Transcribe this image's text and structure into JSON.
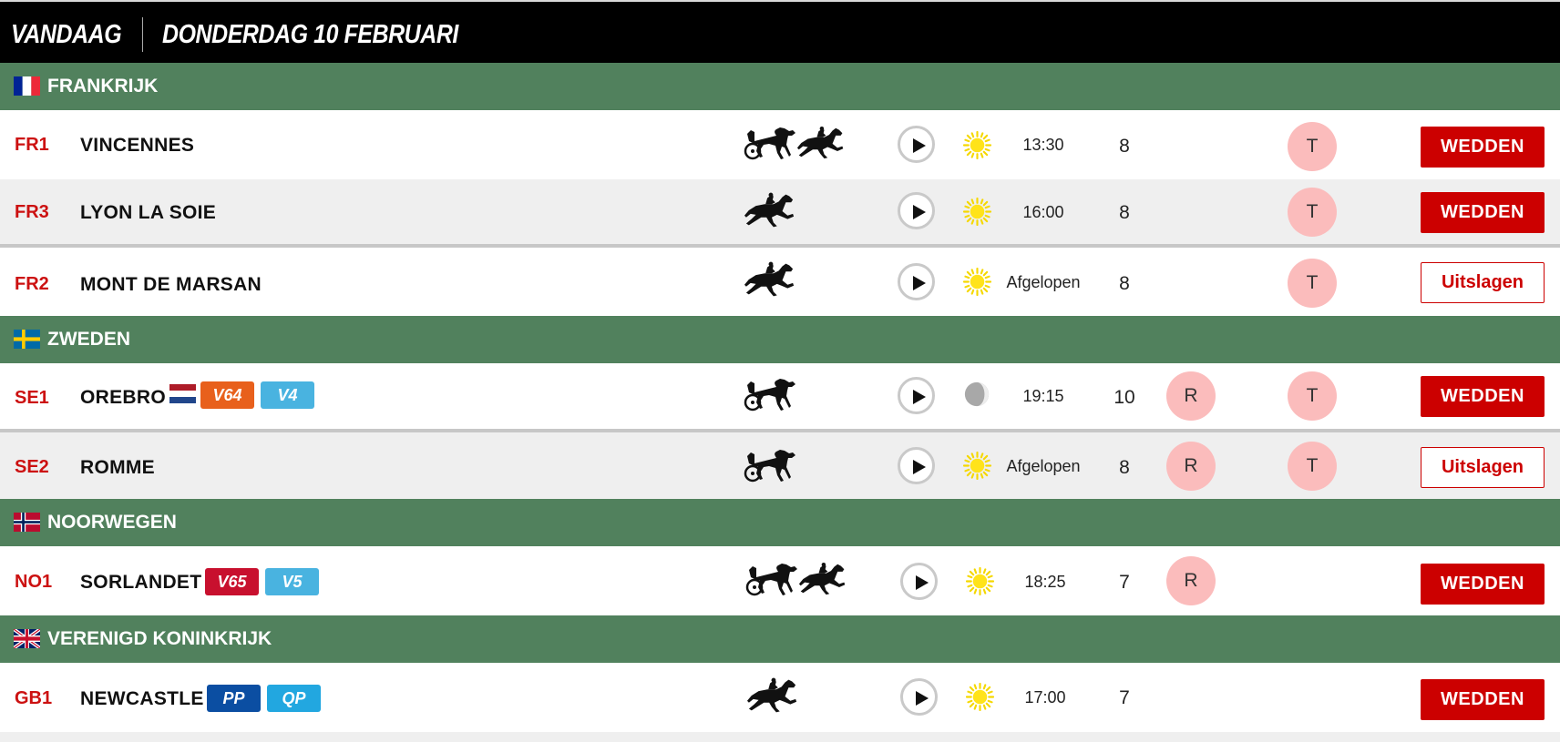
{
  "header": {
    "today_label": "VANDAAG",
    "date_label": "DONDERDAG 10 FEBRUARI"
  },
  "countries": [
    {
      "name": "FRANKRIJK",
      "flag": "france-flag-icon"
    },
    {
      "name": "ZWEDEN",
      "flag": "sweden-flag-icon"
    },
    {
      "name": "NOORWEGEN",
      "flag": "norway-flag-icon"
    },
    {
      "name": "VERENIGD KONINKRIJK",
      "flag": "uk-flag-icon"
    }
  ],
  "races": [
    {
      "code": "FR1",
      "track": "VINCENNES",
      "badges": [],
      "disciplines": [
        "trotting",
        "galloping"
      ],
      "weather": "sun",
      "time": "13:30",
      "count": "8",
      "r": "",
      "t": "T",
      "action": "WEDDEN"
    },
    {
      "code": "FR3",
      "track": "LYON LA SOIE",
      "badges": [],
      "disciplines": [
        "galloping"
      ],
      "weather": "sun",
      "time": "16:00",
      "count": "8",
      "r": "",
      "t": "T",
      "action": "WEDDEN"
    },
    {
      "code": "FR2",
      "track": "MONT DE MARSAN",
      "badges": [],
      "disciplines": [
        "galloping"
      ],
      "weather": "sun",
      "time": "Afgelopen",
      "count": "8",
      "r": "",
      "t": "T",
      "action": "Uitslagen"
    },
    {
      "code": "SE1",
      "track": "OREBRO",
      "badges": [
        "V64",
        "V4"
      ],
      "disciplines": [
        "trotting"
      ],
      "weather": "half-moon",
      "time": "19:15",
      "count": "10",
      "r": "R",
      "t": "T",
      "action": "WEDDEN"
    },
    {
      "code": "SE2",
      "track": "ROMME",
      "badges": [],
      "disciplines": [
        "trotting"
      ],
      "weather": "sun",
      "time": "Afgelopen",
      "count": "8",
      "r": "R",
      "t": "T",
      "action": "Uitslagen"
    },
    {
      "code": "NO1",
      "track": "SORLANDET",
      "badges": [
        "V65",
        "V5"
      ],
      "disciplines": [
        "trotting",
        "galloping"
      ],
      "weather": "sun",
      "time": "18:25",
      "count": "7",
      "r": "R",
      "t": "",
      "action": "WEDDEN"
    },
    {
      "code": "GB1",
      "track": "NEWCASTLE",
      "badges": [
        "PP",
        "QP"
      ],
      "disciplines": [
        "galloping"
      ],
      "weather": "sun",
      "time": "17:00",
      "count": "7",
      "r": "",
      "t": "",
      "action": "WEDDEN"
    }
  ],
  "colors": {
    "country_bar": "#51815d",
    "accent_red": "#cc0000",
    "circle_pink": "#fbbcbc",
    "badge_orange": "#e8601c",
    "badge_light_blue": "#49b3e0",
    "badge_red": "#c8102e",
    "badge_dark_blue": "#0b4ea2"
  }
}
